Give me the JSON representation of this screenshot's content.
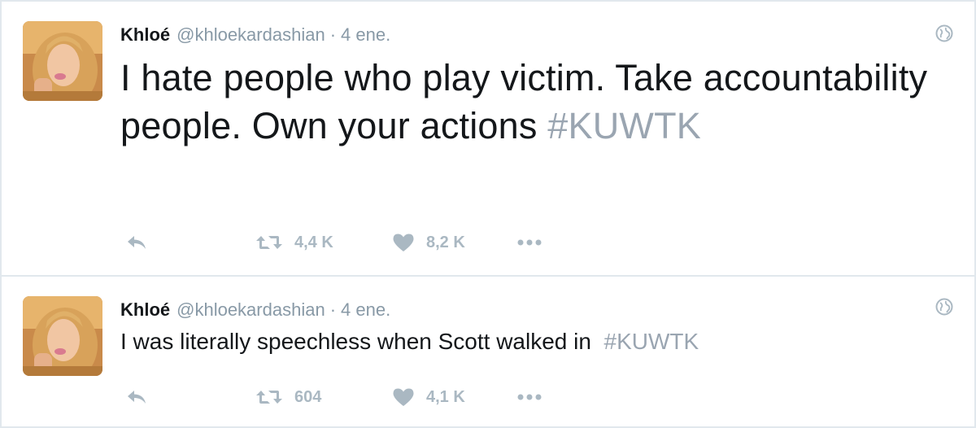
{
  "tweets": [
    {
      "author_name": "Khloé",
      "handle": "@khloekardashian",
      "separator": "·",
      "time": "4 ene.",
      "text": "I hate people who play victim. Take accountability people. Own your actions",
      "hashtag": "#KUWTK",
      "retweets": "4,4 K",
      "likes": "8,2 K"
    },
    {
      "author_name": "Khloé",
      "handle": "@khloekardashian",
      "separator": "·",
      "time": "4 ene.",
      "text": "I was literally speechless when Scott walked in",
      "hashtag": "#KUWTK",
      "retweets": "604",
      "likes": "4,1 K"
    }
  ],
  "icons": {
    "reply": "reply-icon",
    "retweet": "retweet-icon",
    "like": "heart-icon",
    "more": "more-icon",
    "globe": "globe-icon"
  },
  "colors": {
    "text": "#14171a",
    "muted": "#8899a6",
    "action_icons": "#aab8c2",
    "divider": "#e1e8ed",
    "hashtag": "#9aa5b1"
  }
}
